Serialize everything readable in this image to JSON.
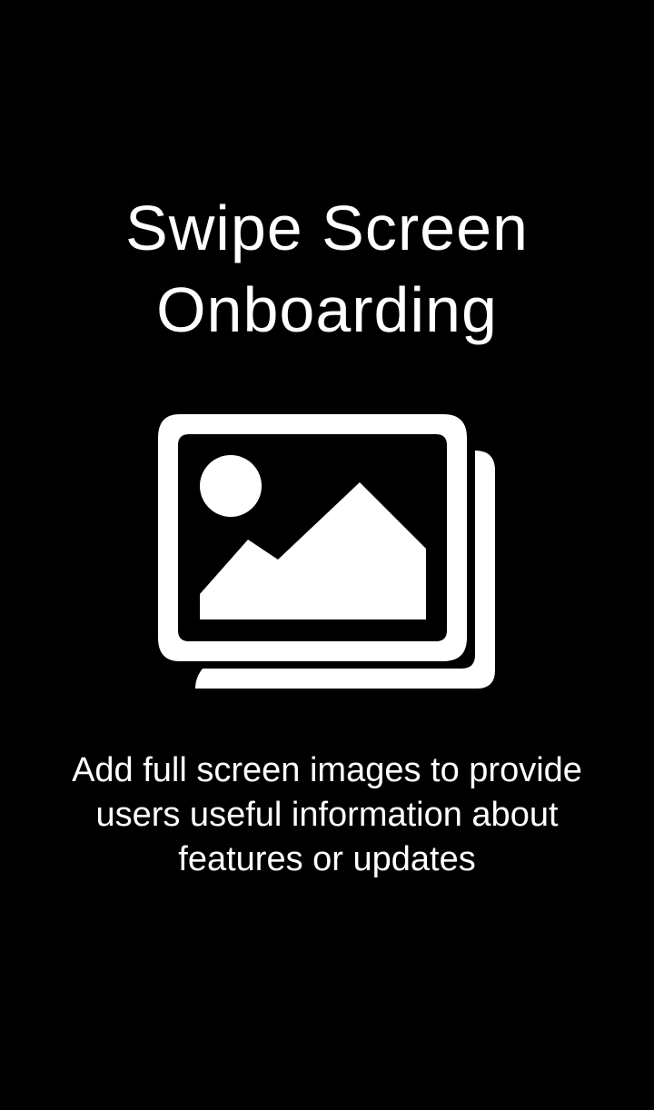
{
  "screen": {
    "title_line1": "Swipe Screen",
    "title_line2": "Onboarding",
    "illustration_icon": "image-gallery-icon",
    "description": "Add full screen images to provide users useful information about features or updates"
  },
  "colors": {
    "background": "#000000",
    "foreground": "#ffffff"
  }
}
